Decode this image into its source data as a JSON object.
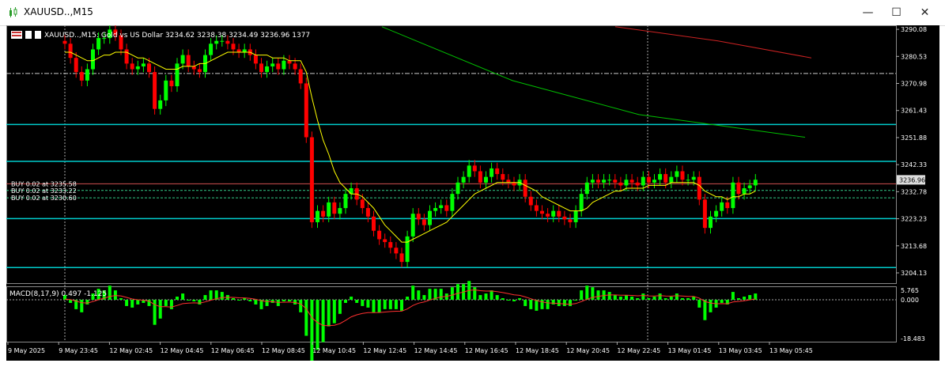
{
  "window": {
    "title": "XAUUSD..,M15",
    "minimize_icon": "minimize-icon",
    "maximize_icon": "maximize-icon",
    "close_icon": "close-icon"
  },
  "chart_header": "XAUUSD..,M15:  Gold vs US Dollar  3234.62 3238.38 3234.49 3236.96  1377",
  "macd_label": "MACD(8,17,9) 0.497 -1.125",
  "orders": [
    {
      "label": "BUY 0.02 at 3235.58",
      "price": 3235.58
    },
    {
      "label": "BUY 0.02 at 3233.22",
      "price": 3233.22
    },
    {
      "label": "BUY 0.02 at 3230.60",
      "price": 3230.6
    }
  ],
  "colors": {
    "background": "#000000",
    "bull": "#00ff00",
    "bear": "#ff0000",
    "hline": "#00cccc",
    "ma_fast": "#ffff00",
    "ma_slow": "#00c000",
    "ma_long": "#cc2222"
  },
  "chart_data": {
    "type": "candlestick",
    "price_axis": {
      "ticks": [
        3290.08,
        3280.53,
        3270.98,
        3261.43,
        3251.88,
        3242.33,
        3232.78,
        3223.23,
        3213.68,
        3204.13
      ],
      "range": [
        3200.5,
        3291.5
      ],
      "current_price": 3236.96
    },
    "time_axis": {
      "labels": [
        "9 May 2025",
        "9 May 23:45",
        "12 May 02:45",
        "12 May 04:45",
        "12 May 06:45",
        "12 May 08:45",
        "12 May 10:45",
        "12 May 12:45",
        "12 May 14:45",
        "12 May 16:45",
        "12 May 18:45",
        "12 May 20:45",
        "12 May 22:45",
        "13 May 01:45",
        "13 May 03:45",
        "13 May 05:45"
      ]
    },
    "horizontal_levels": [
      3274.5,
      3256.5,
      3243.5,
      3223.3,
      3206.0
    ],
    "closes": [
      3285,
      3280,
      3275,
      3272,
      3276,
      3283,
      3287,
      3287,
      3290,
      3288,
      3283,
      3278,
      3276,
      3277,
      3278,
      3275,
      3262,
      3265,
      3272,
      3270,
      3278,
      3281,
      3277,
      3276,
      3275,
      3281,
      3285,
      3286,
      3286,
      3285,
      3283,
      3282,
      3283,
      3281,
      3278,
      3275,
      3277,
      3278,
      3276,
      3279,
      3278,
      3276,
      3271,
      3252,
      3222,
      3226,
      3224,
      3229,
      3225,
      3227,
      3232,
      3234,
      3230,
      3227,
      3224,
      3219,
      3216,
      3215,
      3213,
      3211,
      3208,
      3217,
      3225,
      3223,
      3221,
      3226,
      3227,
      3228,
      3226,
      3232,
      3236,
      3238,
      3242,
      3240,
      3236,
      3238,
      3241,
      3239,
      3237,
      3236,
      3235,
      3237,
      3231,
      3228,
      3226,
      3225,
      3224,
      3226,
      3224,
      3223,
      3222,
      3226,
      3232,
      3236,
      3237,
      3236,
      3237,
      3237,
      3236,
      3235,
      3237,
      3236,
      3235,
      3238,
      3236,
      3237,
      3239,
      3236,
      3238,
      3240,
      3237,
      3237,
      3238,
      3230,
      3220,
      3224,
      3226,
      3229,
      3227,
      3236,
      3232,
      3234,
      3235,
      3237
    ],
    "ma_fast": [
      3282,
      3282,
      3281,
      3280,
      3279,
      3279,
      3280,
      3281,
      3281,
      3282,
      3282,
      3282,
      3281,
      3280,
      3280,
      3279,
      3278,
      3277,
      3276,
      3276,
      3276,
      3277,
      3277,
      3277,
      3278,
      3278,
      3279,
      3280,
      3281,
      3282,
      3282,
      3282,
      3282,
      3282,
      3281,
      3281,
      3281,
      3280,
      3280,
      3280,
      3279,
      3279,
      3279,
      3275,
      3266,
      3258,
      3251,
      3246,
      3240,
      3236,
      3234,
      3232,
      3232,
      3231,
      3229,
      3227,
      3224,
      3221,
      3219,
      3217,
      3215,
      3215,
      3216,
      3217,
      3218,
      3219,
      3220,
      3221,
      3222,
      3224,
      3226,
      3228,
      3230,
      3232,
      3233,
      3234,
      3235,
      3236,
      3236,
      3236,
      3236,
      3236,
      3235,
      3234,
      3233,
      3231,
      3230,
      3229,
      3228,
      3227,
      3226,
      3226,
      3226,
      3227,
      3229,
      3230,
      3231,
      3232,
      3233,
      3233,
      3234,
      3234,
      3234,
      3234,
      3235,
      3235,
      3235,
      3235,
      3236,
      3236,
      3236,
      3236,
      3236,
      3235,
      3233,
      3232,
      3231,
      3231,
      3230,
      3231,
      3231,
      3232,
      3232,
      3233
    ]
  }
}
